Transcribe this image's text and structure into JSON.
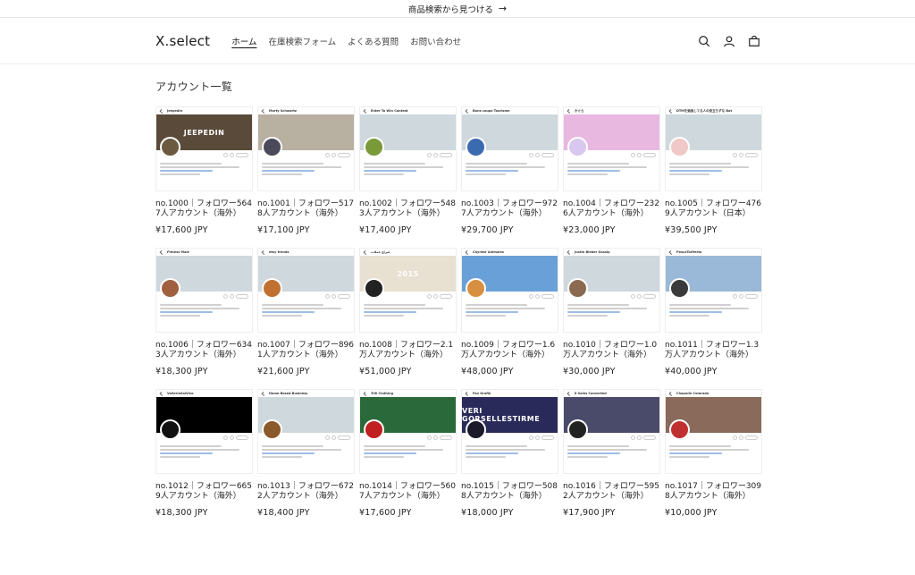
{
  "announcement": {
    "text": "商品検索から見つける",
    "arrow": "→"
  },
  "header": {
    "logo": "X.select",
    "nav": [
      {
        "label": "ホーム",
        "active": true
      },
      {
        "label": "在庫検索フォーム",
        "active": false
      },
      {
        "label": "よくある質問",
        "active": false
      },
      {
        "label": "お問い合わせ",
        "active": false
      }
    ],
    "icons": [
      "search-icon",
      "account-icon",
      "cart-icon"
    ]
  },
  "main": {
    "title": "アカウント一覧",
    "products": [
      {
        "profile": "Jeepedin",
        "banner": "#5a4a3a",
        "banner_text": "JEEPEDIN",
        "avatar": "#6b5a40",
        "title": "no.1000｜フォロワー5647人アカウント（海外）",
        "price": "¥17,600 JPY"
      },
      {
        "profile": "Morty Schwartz",
        "banner": "#b8b0a0",
        "banner_text": "",
        "avatar": "#4a4a5a",
        "title": "no.1001｜フォロワー5178人アカウント（海外）",
        "price": "¥17,100 JPY"
      },
      {
        "profile": "Enter To Win Contest",
        "banner": "#cfd8dc",
        "banner_text": "",
        "avatar": "#7a9a3a",
        "title": "no.1002｜フォロワー5483人アカウント（海外）",
        "price": "¥17,400 JPY"
      },
      {
        "profile": "Bons coups Tourisme",
        "banner": "#cfd8dc",
        "banner_text": "",
        "avatar": "#3a6ab0",
        "title": "no.1003｜フォロワー9727人アカウント（海外）",
        "price": "¥29,700 JPY"
      },
      {
        "profile": "かぐら",
        "banner": "#e8b8e0",
        "banner_text": "",
        "avatar": "#d8c8f0",
        "title": "no.1004｜フォロワー2326人アカウント（海外）",
        "price": "¥23,000 JPY"
      },
      {
        "profile": "DTMを勉強してる人の役立ちずな Bot",
        "banner": "#cfd8dc",
        "banner_text": "",
        "avatar": "#f0c8c8",
        "title": "no.1005｜フォロワー4769人アカウント（日本）",
        "price": "¥39,500 JPY"
      },
      {
        "profile": "Fitness Male",
        "banner": "#cfd8dc",
        "banner_text": "",
        "avatar": "#a06040",
        "title": "no.1006｜フォロワー6343人アカウント（海外）",
        "price": "¥18,300 JPY"
      },
      {
        "profile": "etsy trends",
        "banner": "#cfd8dc",
        "banner_text": "",
        "avatar": "#c07030",
        "title": "no.1007｜フォロワー8961人アカウント（海外）",
        "price": "¥21,600 JPY"
      },
      {
        "profile": "صراع عملات",
        "banner": "#e8e0d0",
        "banner_text": "2015",
        "avatar": "#222222",
        "title": "no.1008｜フォロワー2.1万人アカウント（海外）",
        "price": "¥51,000 JPY"
      },
      {
        "profile": "Chyntor Animales",
        "banner": "#6aa0d8",
        "banner_text": "",
        "avatar": "#d89040",
        "title": "no.1009｜フォロワー1.6万人アカウント（海外）",
        "price": "¥48,000 JPY"
      },
      {
        "profile": "Justin Bieber Gossip",
        "banner": "#cfd8dc",
        "banner_text": "",
        "avatar": "#8a6a50",
        "title": "no.1010｜フォロワー1.0万人アカウント（海外）",
        "price": "¥30,000 JPY"
      },
      {
        "profile": "PescaToOferta",
        "banner": "#9ab8d8",
        "banner_text": "",
        "avatar": "#3a3a3a",
        "title": "no.1011｜フォロワー1.3万人アカウント（海外）",
        "price": "¥40,000 JPY"
      },
      {
        "profile": "ValleriaSalVivo",
        "banner": "#000000",
        "banner_text": "",
        "avatar": "#111111",
        "title": "no.1012｜フォロワー6659人アカウント（海外）",
        "price": "¥18,300 JPY"
      },
      {
        "profile": "Home Based Business",
        "banner": "#cfd8dc",
        "banner_text": "",
        "avatar": "#8a5a2a",
        "title": "no.1013｜フォロワー6722人アカウント（海外）",
        "price": "¥18,400 JPY"
      },
      {
        "profile": "Trill Clothing",
        "banner": "#2a6a3a",
        "banner_text": "",
        "avatar": "#c02020",
        "title": "no.1014｜フォロワー5607人アカウント（海外）",
        "price": "¥17,600 JPY"
      },
      {
        "profile": "Fan Grafik",
        "banner": "#2a2a5a",
        "banner_text": "VERI GORSELLESTIRME",
        "avatar": "#1a1a2a",
        "title": "no.1015｜フォロワー5088人アカウント（海外）",
        "price": "¥18,000 JPY"
      },
      {
        "profile": "8 Sales Converted",
        "banner": "#4a4a6a",
        "banner_text": "",
        "avatar": "#222222",
        "title": "no.1016｜フォロワー5952人アカウント（海外）",
        "price": "¥17,900 JPY"
      },
      {
        "profile": "Chapulin Colorado",
        "banner": "#8a6a5a",
        "banner_text": "",
        "avatar": "#c03030",
        "title": "no.1017｜フォロワー3098人アカウント（海外）",
        "price": "¥10,000 JPY"
      }
    ]
  }
}
